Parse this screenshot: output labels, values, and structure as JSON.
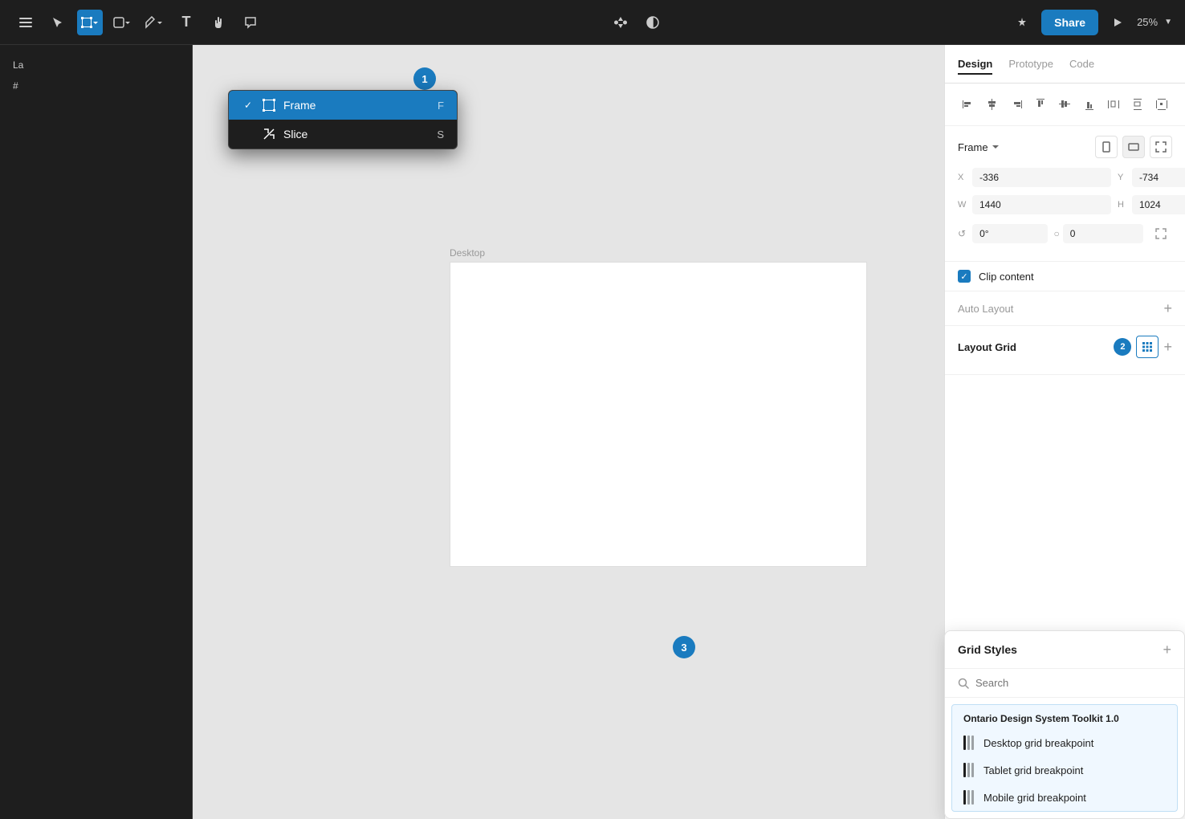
{
  "toolbar": {
    "menu_icon": "☰",
    "share_label": "Share",
    "zoom_label": "25%",
    "present_icon": "▶"
  },
  "dropdown": {
    "items": [
      {
        "id": "frame",
        "label": "Frame",
        "shortcut": "F",
        "selected": true,
        "icon": "⊞"
      },
      {
        "id": "slice",
        "label": "Slice",
        "shortcut": "S",
        "selected": false,
        "icon": "✂"
      }
    ]
  },
  "canvas": {
    "frame_label": "Desktop"
  },
  "badges": {
    "b1": "1",
    "b2": "2",
    "b3": "3"
  },
  "right_panel": {
    "tabs": [
      {
        "id": "design",
        "label": "Design",
        "active": true
      },
      {
        "id": "prototype",
        "label": "Prototype",
        "active": false
      },
      {
        "id": "code",
        "label": "Code",
        "active": false
      }
    ],
    "frame_section": {
      "label": "Frame",
      "x_label": "X",
      "x_value": "-336",
      "y_label": "Y",
      "y_value": "-734",
      "w_label": "W",
      "w_value": "1440",
      "h_label": "H",
      "h_value": "1024",
      "angle_label": "°",
      "angle_value": "0°",
      "radius_label": "○",
      "radius_value": "0"
    },
    "clip_content_label": "Clip content",
    "auto_layout_label": "Auto Layout",
    "layout_grid_label": "Layout Grid"
  },
  "grid_styles": {
    "title": "Grid Styles",
    "search_placeholder": "Search",
    "library_name": "Ontario Design System Toolkit 1.0",
    "items": [
      {
        "id": "desktop",
        "label": "Desktop grid breakpoint"
      },
      {
        "id": "tablet",
        "label": "Tablet grid breakpoint"
      },
      {
        "id": "mobile",
        "label": "Mobile grid breakpoint"
      }
    ]
  }
}
